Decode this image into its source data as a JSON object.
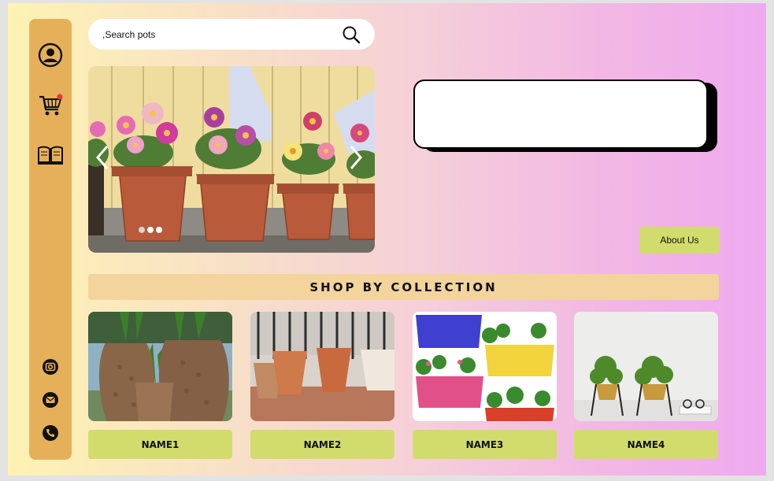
{
  "sidebar": {
    "items": [
      {
        "icon": "user-icon"
      },
      {
        "icon": "cart-icon",
        "badge_color": "#e53935"
      },
      {
        "icon": "book-icon"
      }
    ],
    "social": [
      {
        "icon": "camera-icon"
      },
      {
        "icon": "mail-icon"
      },
      {
        "icon": "phone-icon"
      }
    ]
  },
  "search": {
    "placeholder": ",Search pots",
    "icon": "search-icon"
  },
  "hero": {
    "prev_icon": "chevron-left-icon",
    "next_icon": "chevron-right-icon",
    "slide_count": 3,
    "active_slide": 2
  },
  "about": {
    "label": "About Us"
  },
  "collection": {
    "title": "SHOP BY COLLECTION"
  },
  "products": [
    {
      "name": "NAME1"
    },
    {
      "name": "NAME2"
    },
    {
      "name": "NAME3"
    },
    {
      "name": "NAME4"
    }
  ],
  "colors": {
    "sidebar": "#e6b05a",
    "accent_button": "#d2dc6c",
    "collection_bar": "#f3d49c"
  }
}
